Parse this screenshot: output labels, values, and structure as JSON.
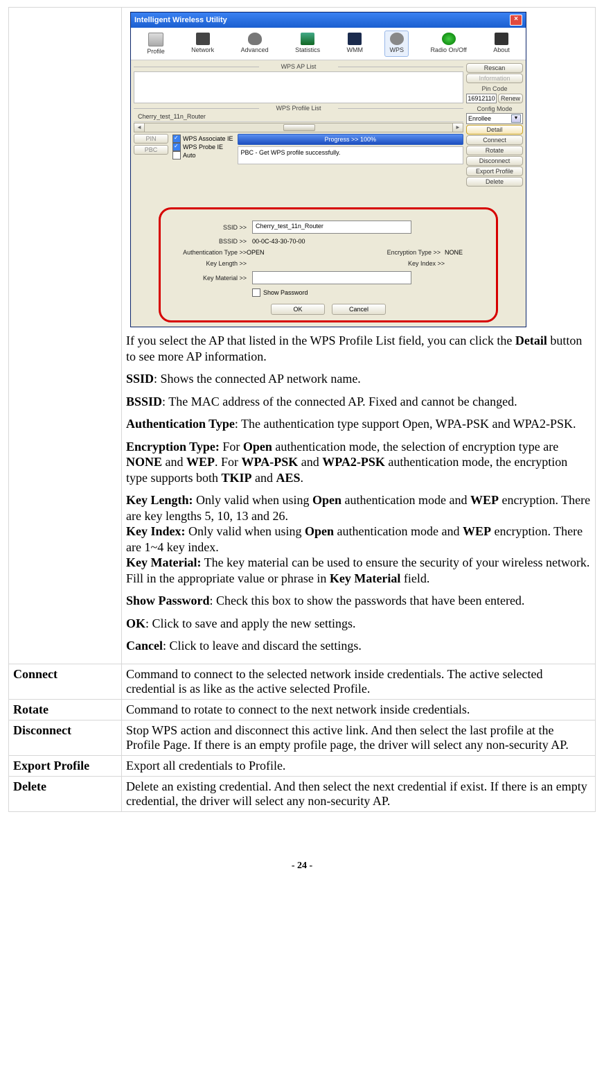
{
  "app": {
    "title": "Intelligent Wireless Utility",
    "tabs": [
      "Profile",
      "Network",
      "Advanced",
      "Statistics",
      "WMM",
      "WPS",
      "Radio On/Off",
      "About"
    ],
    "wps_ap_list_label": "WPS AP List",
    "wps_profile_list_label": "WPS Profile List",
    "profile_entry": "Cherry_test_11n_Router",
    "side": {
      "rescan": "Rescan",
      "information": "Information",
      "pin_code_label": "Pin Code",
      "pin_code": "16912110",
      "renew": "Renew",
      "config_mode_label": "Config Mode",
      "config_mode_value": "Enrollee",
      "detail": "Detail",
      "connect": "Connect",
      "rotate": "Rotate",
      "disconnect": "Disconnect",
      "export_profile": "Export Profile",
      "delete": "Delete"
    },
    "left_buttons": {
      "pin": "PIN",
      "pbc": "PBC"
    },
    "checks": {
      "assoc": "WPS Associate IE",
      "probe": "WPS Probe IE",
      "auto": "Auto"
    },
    "progress_label": "Progress >> 100%",
    "status_msg": "PBC - Get WPS profile successfully.",
    "detail": {
      "ssid_label": "SSID >>",
      "ssid_value": "Cherry_test_11n_Router",
      "bssid_label": "BSSID >>",
      "bssid_value": "00-0C-43-30-70-00",
      "auth_label": "Authentication Type >>",
      "auth_value": "OPEN",
      "enc_label": "Encryption Type >>",
      "enc_value": "NONE",
      "keylen_label": "Key Length >>",
      "keyidx_label": "Key Index >>",
      "keymat_label": "Key Material >>",
      "showpw": "Show Password",
      "ok": "OK",
      "cancel": "Cancel"
    }
  },
  "doc": {
    "intro_a": "If you select the AP that listed in the WPS Profile List field, you can click the ",
    "intro_b": "Detail",
    "intro_c": " button to see more AP information.",
    "ssid_l": "SSID",
    "ssid_t": ": Shows the connected AP network name.",
    "bssid_l": "BSSID",
    "bssid_t": ": The MAC address of the connected AP. Fixed and cannot be changed.",
    "auth_l": "Authentication Type",
    "auth_t": ": The authentication type support Open, WPA-PSK and WPA2-PSK.",
    "enc_l": "Encryption Type:",
    "enc_t1": " For ",
    "enc_b1": "Open",
    "enc_t2": " authentication mode, the selection of encryption type are ",
    "enc_b2": "NONE",
    "enc_t3": " and ",
    "enc_b3": "WEP",
    "enc_t4": ". For ",
    "enc_b4": "WPA-PSK",
    "enc_t5": " and ",
    "enc_b5": "WPA2-PSK",
    "enc_t6": " authentication mode, the encryption type supports both ",
    "enc_b6": "TKIP",
    "enc_t7": " and ",
    "enc_b7": "AES",
    "enc_t8": ".",
    "kl_l": "Key Length:",
    "kl_t1": " Only valid when using ",
    "kl_b1": "Open",
    "kl_t2": " authentication mode and ",
    "kl_b2": "WEP",
    "kl_t3": " encryption. There are key lengths 5, 10, 13 and 26.",
    "ki_l": "Key Index:",
    "ki_t1": " Only valid when using ",
    "ki_b1": "Open",
    "ki_t2": " authentication mode and ",
    "ki_b2": "WEP",
    "ki_t3": " encryption. There are 1~4 key index.",
    "km_l": "Key Material:",
    "km_t1": " The key material can be used to ensure the security of your wireless network. Fill in the appropriate value or phrase in ",
    "km_b1": "Key Material",
    "km_t2": " field.",
    "sp_l": "Show Password",
    "sp_t": ": Check this box to show the passwords that have been entered.",
    "ok_l": "OK",
    "ok_t": ": Click to save and apply the new settings.",
    "ca_l": "Cancel",
    "ca_t": ": Click to leave and discard the settings."
  },
  "rows": {
    "connect_l": "Connect",
    "connect_t": "Command to connect to the selected network inside credentials. The active selected credential is as like as the active selected Profile.",
    "rotate_l": "Rotate",
    "rotate_t": "Command to rotate to connect to the next network inside credentials.",
    "disconnect_l": "Disconnect",
    "disconnect_t": "Stop WPS action and disconnect this active link. And then select the last profile at the Profile Page. If there is an empty profile page, the driver will select any non-security AP.",
    "export_l": "Export Profile",
    "export_t": "Export all credentials to Profile.",
    "delete_l": "Delete",
    "delete_t": "Delete an existing credential. And then select the next credential if exist. If there is an empty credential, the driver will select any non-security AP."
  },
  "page_num": "- 24 -"
}
